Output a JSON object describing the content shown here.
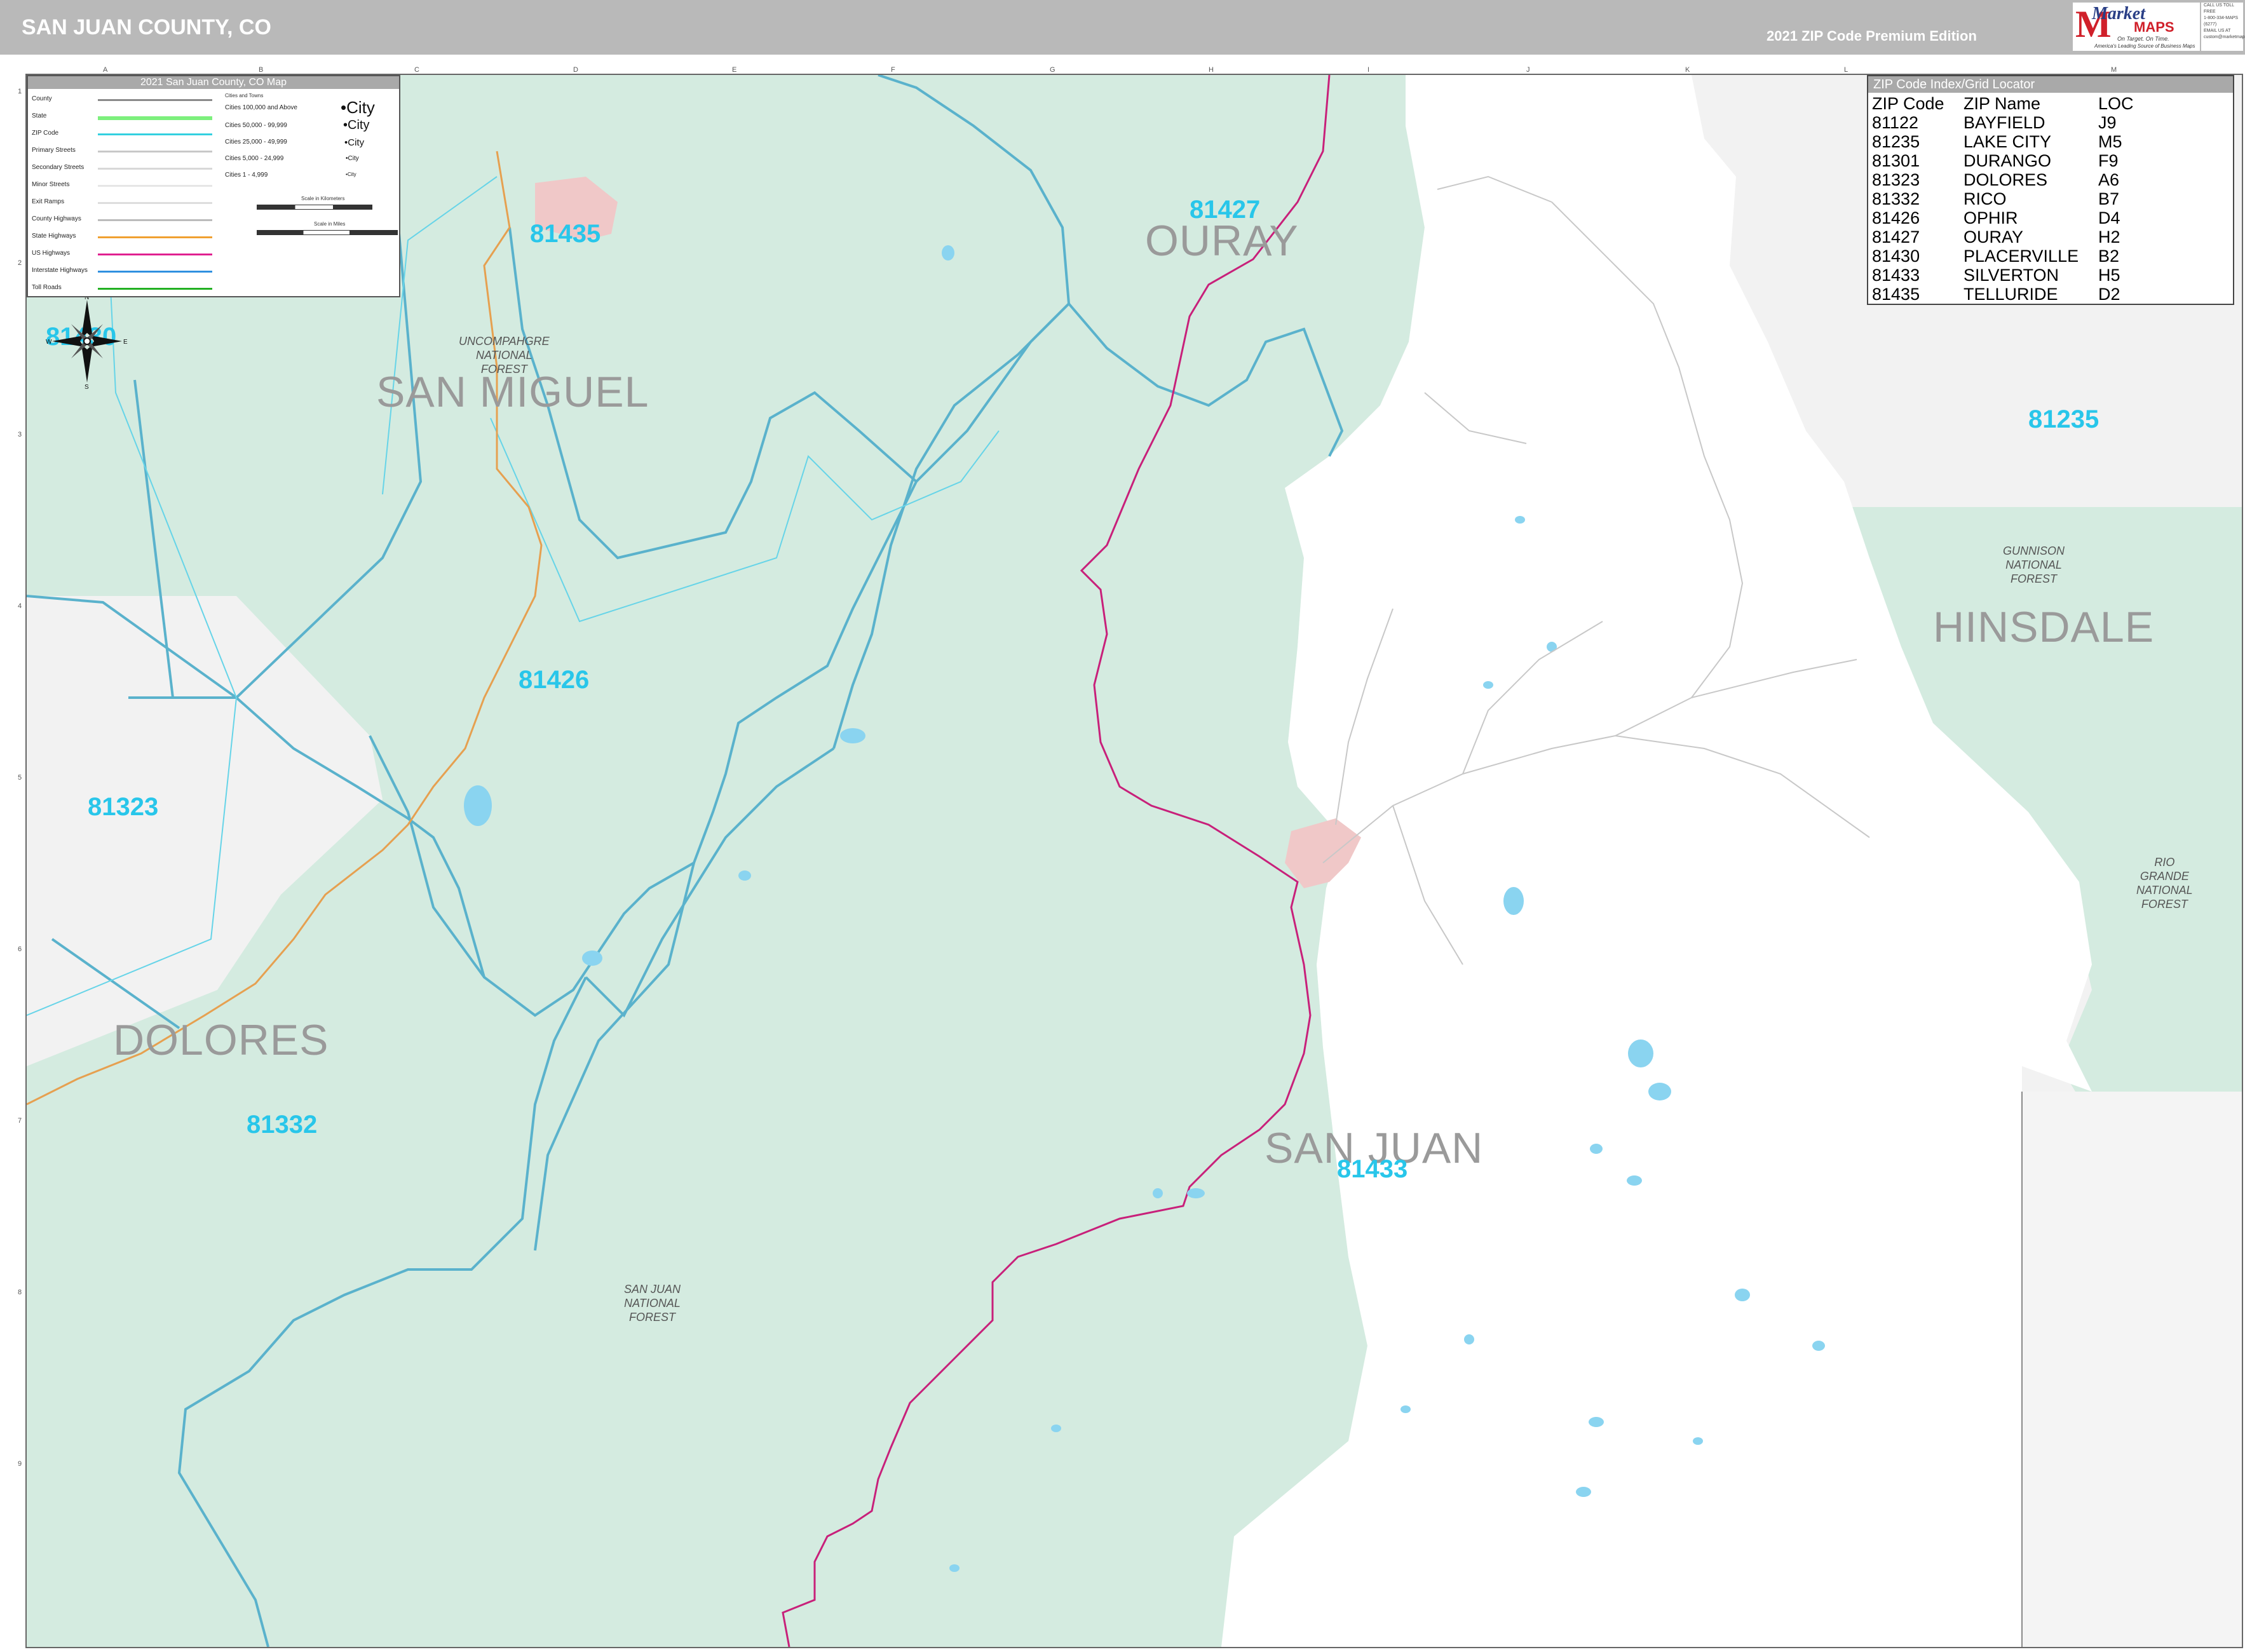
{
  "header": {
    "title": "SAN JUAN COUNTY, CO",
    "edition": "2021 ZIP Code Premium Edition",
    "logo": {
      "brand_word1": "Market",
      "brand_word2": "MAPS",
      "tagline1": "On Target. On Time.",
      "tagline2": "America's Leading Source of Business Maps"
    },
    "contact_lines": [
      "CALL US TOLL FREE",
      "1-800-334-MAPS (6277)",
      "EMAIL US AT",
      "custom@marketmaps.com"
    ]
  },
  "grid": {
    "columns": [
      "A",
      "B",
      "C",
      "D",
      "E",
      "F",
      "G",
      "H",
      "I",
      "J",
      "K",
      "L",
      "M"
    ],
    "rows": [
      "1",
      "2",
      "3",
      "4",
      "5",
      "6",
      "7",
      "8",
      "9"
    ]
  },
  "legend": {
    "title": "2021 San Juan County, CO Map",
    "items": [
      "County",
      "State",
      "ZIP Code",
      "Primary Streets",
      "Secondary Streets",
      "Minor Streets",
      "Exit Ramps",
      "County Highways",
      "State Highways",
      "US Highways",
      "Interstate Highways",
      "Toll Roads"
    ],
    "colors": [
      "#8a8a8a",
      "#7df07d",
      "#33d0e0",
      "#c8c8c8",
      "#d8d8d8",
      "#e6e6e6",
      "#dddddd",
      "#bbbbbb",
      "#f0a030",
      "#e02090",
      "#3090e0",
      "#22b022"
    ],
    "cities_header": "Cities and Towns",
    "city_classes": [
      "Cities 100,000 and Above",
      "Cities 50,000 - 99,999",
      "Cities 25,000 - 49,999",
      "Cities 5,000 - 24,999",
      "Cities 1 - 4,999"
    ],
    "city_samples": [
      "City",
      "City",
      "City",
      "City",
      "City"
    ],
    "scale_km": "Scale in Kilometers",
    "scale_mi": "Scale in Miles"
  },
  "zip_index": {
    "title": "ZIP Code Index/Grid Locator",
    "headers": [
      "ZIP Code",
      "ZIP Name",
      "LOC"
    ],
    "rows": [
      [
        "81122",
        "BAYFIELD",
        "J9"
      ],
      [
        "81235",
        "LAKE CITY",
        "M5"
      ],
      [
        "81301",
        "DURANGO",
        "F9"
      ],
      [
        "81323",
        "DOLORES",
        "A6"
      ],
      [
        "81332",
        "RICO",
        "B7"
      ],
      [
        "81426",
        "OPHIR",
        "D4"
      ],
      [
        "81427",
        "OURAY",
        "H2"
      ],
      [
        "81430",
        "PLACERVILLE",
        "B2"
      ],
      [
        "81433",
        "SILVERTON",
        "H5"
      ],
      [
        "81435",
        "TELLURIDE",
        "D2"
      ]
    ]
  },
  "counties": [
    "OURAY",
    "SAN MIGUEL",
    "HINSDALE",
    "DOLORES",
    "SAN JUAN"
  ],
  "zip_labels": [
    "81427",
    "81435",
    "81235",
    "81426",
    "81323",
    "81332",
    "81433",
    "81430"
  ],
  "forests": [
    "UNCOMPAHGRE\nNATIONAL\nFOREST",
    "GUNNISON\nNATIONAL\nFOREST",
    "RIO\nGRANDE\nNATIONAL\nFOREST",
    "SAN JUAN\nNATIONAL\nFOREST"
  ],
  "compass": {
    "n": "N",
    "s": "S",
    "e": "E",
    "w": "W"
  },
  "colors": {
    "forest": "#d4ebe0",
    "zip_boundary": "#5ab2cc",
    "zip_label": "#28c6ea",
    "county_label": "#9a9a9a",
    "us_highway": "#c8207a",
    "state_highway": "#e6a050",
    "outside": "#f2f2f2"
  }
}
